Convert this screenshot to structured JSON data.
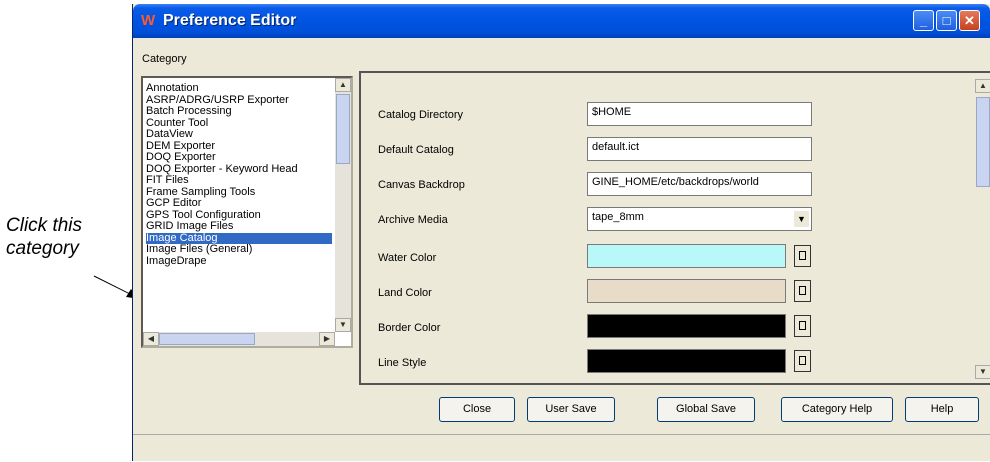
{
  "callout": {
    "line1": "Click this",
    "line2": "category"
  },
  "window": {
    "title": "Preference Editor"
  },
  "category": {
    "label": "Category",
    "items": [
      "Annotation",
      "ASRP/ADRG/USRP Exporter",
      "Batch Processing",
      "Counter Tool",
      "DataView",
      "DEM Exporter",
      "DOQ Exporter",
      "DOQ Exporter - Keyword Head",
      "FIT Files",
      "Frame Sampling Tools",
      "GCP Editor",
      "GPS Tool Configuration",
      "GRID Image Files",
      "Image Catalog",
      "Image Files (General)",
      "ImageDrape"
    ],
    "selected": "Image Catalog"
  },
  "fields": {
    "catalog_directory": {
      "label": "Catalog Directory",
      "value": "$HOME"
    },
    "default_catalog": {
      "label": "Default Catalog",
      "value": "default.ict"
    },
    "canvas_backdrop": {
      "label": "Canvas Backdrop",
      "value": "GINE_HOME/etc/backdrops/world"
    },
    "archive_media": {
      "label": "Archive Media",
      "value": "tape_8mm"
    },
    "water_color": {
      "label": "Water Color",
      "color": "#b8f8f8"
    },
    "land_color": {
      "label": "Land Color",
      "color": "#e8dcc8"
    },
    "border_color": {
      "label": "Border Color",
      "color": "#000000"
    },
    "line_style": {
      "label": "Line Style",
      "color": "#000000"
    }
  },
  "buttons": {
    "close": "Close",
    "user_save": "User Save",
    "global_save": "Global Save",
    "category_help": "Category Help",
    "help": "Help"
  }
}
